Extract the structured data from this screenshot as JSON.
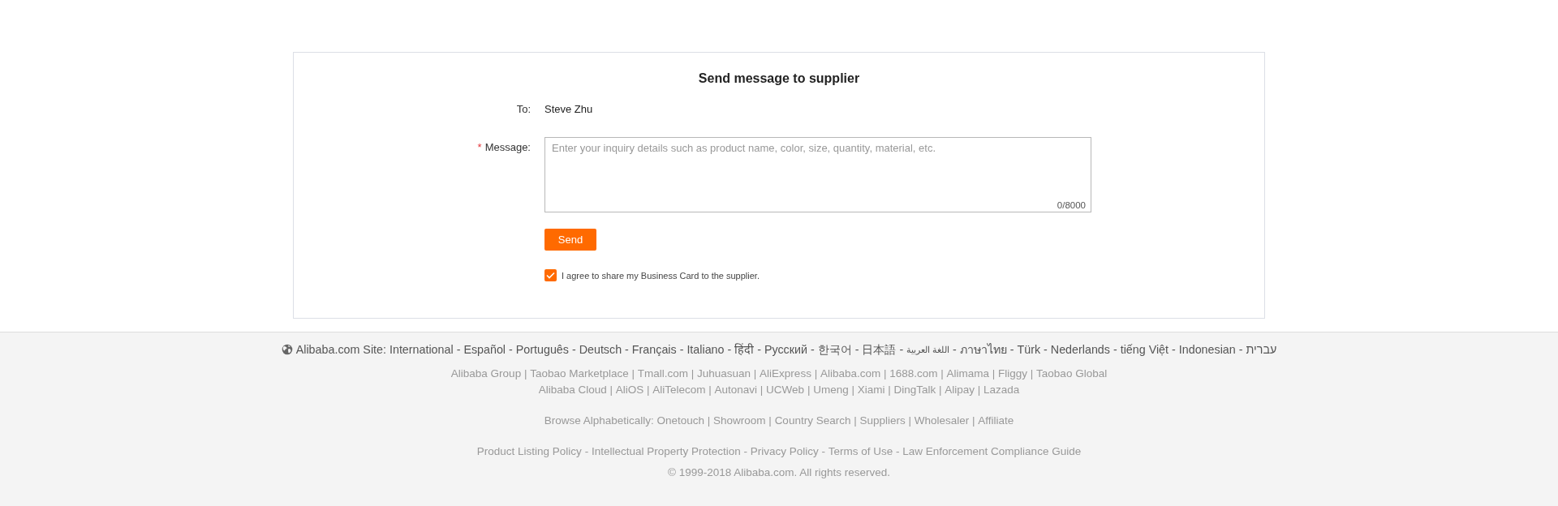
{
  "form": {
    "title": "Send message to supplier",
    "to": {
      "label": "To:",
      "value": "Steve Zhu"
    },
    "message": {
      "label": "Message:",
      "required": true,
      "required_mark": "*",
      "placeholder": "Enter your inquiry details such as product name, color, size, quantity, material, etc.",
      "counter": "0/8000"
    },
    "send_button": "Send",
    "agreement": {
      "checked": true,
      "label": "I agree to share my Business Card to the supplier."
    }
  },
  "footer": {
    "language_bar": {
      "label": "Alibaba.com Site:",
      "separator": "-",
      "languages": [
        "International",
        "Español",
        "Português",
        "Deutsch",
        "Français",
        "Italiano",
        "हिंदी",
        "Русский",
        "한국어",
        "日本語",
        "اللغة العربية",
        "ภาษาไทย",
        "Türk",
        "Nederlands",
        "tiếng Việt",
        "Indonesian",
        "עברית"
      ]
    },
    "group_links": {
      "separator": "|",
      "lines": [
        {
          "links": [
            "Alibaba Group",
            "Taobao Marketplace",
            "Tmall.com",
            "Juhuasuan",
            "AliExpress",
            "Alibaba.com",
            "1688.com",
            "Alimama",
            "Fliggy",
            "Taobao Global"
          ]
        },
        {
          "links": [
            "Alibaba Cloud",
            "AliOS",
            "AliTelecom",
            "Autonavi",
            "UCWeb",
            "Umeng",
            "Xiami",
            "DingTalk",
            "Alipay",
            "Lazada"
          ]
        }
      ]
    },
    "browse": {
      "label": "Browse Alphabetically:",
      "separator": "|",
      "links": [
        "Onetouch",
        "Showroom",
        "Country Search",
        "Suppliers",
        "Wholesaler",
        "Affiliate"
      ]
    },
    "policies": {
      "separator": "-",
      "links": [
        "Product Listing Policy",
        "Intellectual Property Protection",
        "Privacy Policy",
        "Terms of Use",
        "Law Enforcement Compliance Guide"
      ]
    },
    "copyright": "© 1999-2018 Alibaba.com. All rights reserved."
  }
}
